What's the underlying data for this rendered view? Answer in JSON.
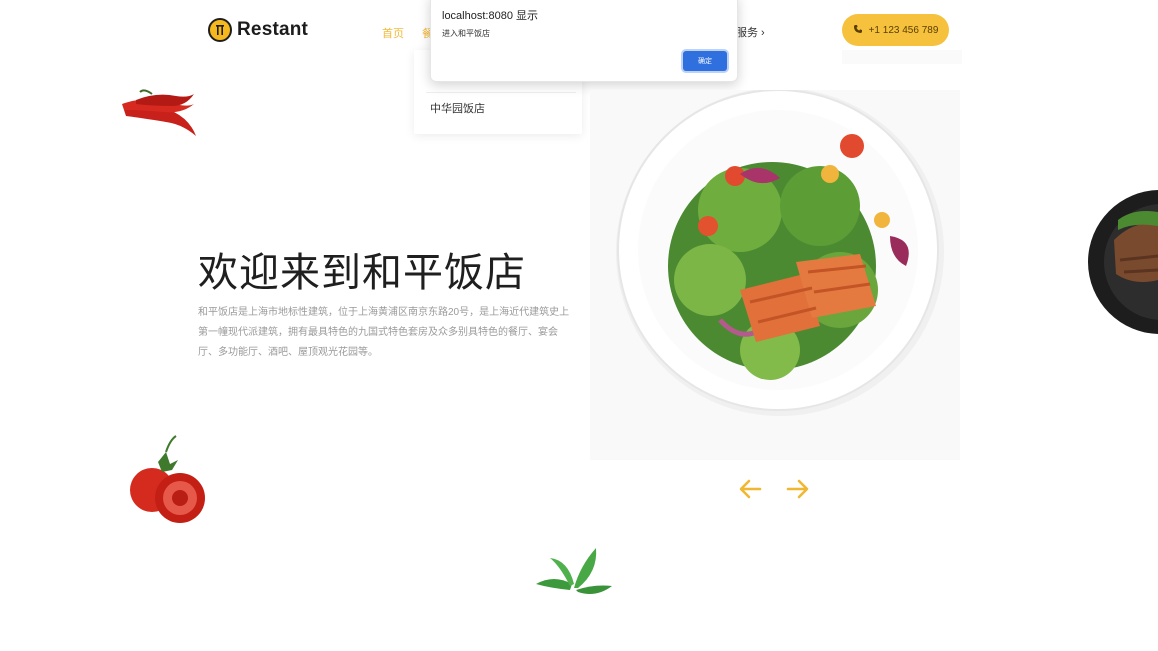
{
  "brand": {
    "name": "Restant"
  },
  "nav": {
    "home": "首页",
    "partial": "餐",
    "services": "服务 ›"
  },
  "phone": {
    "label": "+1 123 456 789",
    "icon": "phone-icon"
  },
  "dropdown": {
    "item": "中华园饭店"
  },
  "dialog": {
    "title": "localhost:8080 显示",
    "message": "进入和平饭店",
    "ok": "确定"
  },
  "hero": {
    "title": "欢迎来到和平饭店",
    "description": "和平饭店是上海市地标性建筑，位于上海黄浦区南京东路20号，是上海近代建筑史上第一幢现代派建筑，拥有最具特色的九国式特色套房及众多别具特色的餐厅、宴会厅、多功能厅、酒吧、屋顶观光花园等。"
  },
  "carousel": {
    "prev_icon": "arrow-left-icon",
    "next_icon": "arrow-right-icon"
  },
  "colors": {
    "accent": "#f6c23e",
    "dialog_button": "#2f6fde"
  }
}
